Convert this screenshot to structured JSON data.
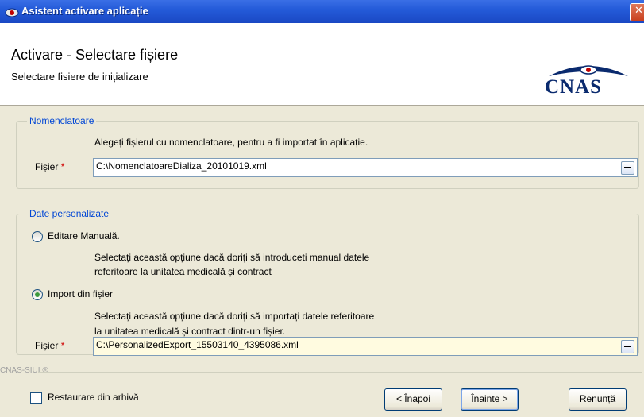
{
  "window": {
    "title": "Asistent activare aplicație"
  },
  "header": {
    "title": "Activare - Selectare fișiere",
    "subtitle": "Selectare fisiere de inițializare",
    "logo_text": "CNAS"
  },
  "nomenclatoare": {
    "group_label": "Nomenclatoare",
    "instruction": "Alegeți fișierul cu nomenclatoare, pentru a fi importat în aplicație.",
    "file_label": "Fișier",
    "required_mark": "*",
    "file_value": "C:\\NomenclatoareDializa_20101019.xml"
  },
  "date_personalizate": {
    "group_label": "Date personalizate",
    "manual_option": "Editare Manuală.",
    "manual_desc_1": "Selectați această opțiune dacă doriți să introduceti manual datele",
    "manual_desc_2": "referitoare la unitatea medicală și contract",
    "import_option": "Import din fișier",
    "import_desc_1": "Selectați această opțiune dacă doriți să importați datele referitoare",
    "import_desc_2": "la unitatea medicală și contract dintr-un fișier.",
    "file_label": "Fișier",
    "required_mark": "*",
    "file_value": "C:\\PersonalizedExport_15503140_4395086.xml"
  },
  "footer": {
    "brand": "CNAS-SIUI ®",
    "restore_label": "Restaurare din arhivă",
    "back_button": "< Înapoi",
    "next_button": "Înainte >",
    "cancel_button": "Renunță"
  }
}
